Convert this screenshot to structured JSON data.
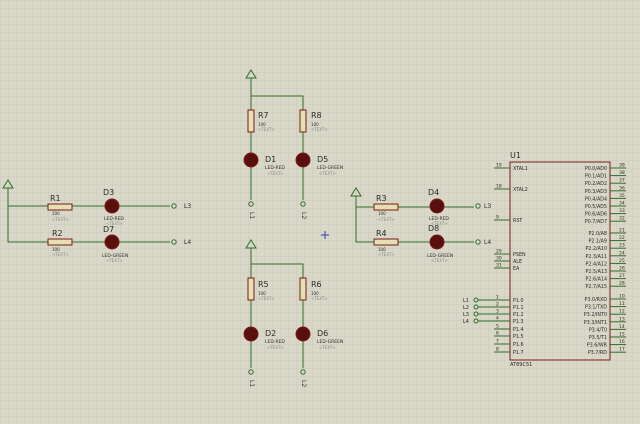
{
  "colors": {
    "background": "#d9d8c8",
    "grid": "#c2c1b0",
    "wire": "#2f6e2a",
    "body_outline": "#7a1a1a",
    "resistor_fill": "#e6dfb3",
    "led_fill": "#5a0f0f",
    "text": "#2a2a2a",
    "placeholder": "#8a8a8a",
    "marker": "#2a3cc4"
  },
  "resistors": [
    {
      "ref": "R1",
      "value": "100",
      "text": "<TEXT>"
    },
    {
      "ref": "R2",
      "value": "100",
      "text": "<TEXT>"
    },
    {
      "ref": "R7",
      "value": "100",
      "text": "<TEXT>"
    },
    {
      "ref": "R8",
      "value": "100",
      "text": "<TEXT>"
    },
    {
      "ref": "R5",
      "value": "100",
      "text": "<TEXT>"
    },
    {
      "ref": "R6",
      "value": "100",
      "text": "<TEXT>"
    },
    {
      "ref": "R3",
      "value": "100",
      "text": "<TEXT>"
    },
    {
      "ref": "R4",
      "value": "100",
      "text": "<TEXT>"
    }
  ],
  "leds": [
    {
      "ref": "D3",
      "type": "LED-RED",
      "text": "<TEXT>",
      "net": "L3"
    },
    {
      "ref": "D7",
      "type": "LED-GREEN",
      "text": "<TEXT>",
      "net": "L4"
    },
    {
      "ref": "D1",
      "type": "LED-RED",
      "text": "<TEXT>",
      "net": "L1"
    },
    {
      "ref": "D5",
      "type": "LED-GREEN",
      "text": "<TEXT>",
      "net": "L2"
    },
    {
      "ref": "D2",
      "type": "LED-RED",
      "text": "<TEXT>",
      "net": "L1"
    },
    {
      "ref": "D6",
      "type": "LED-GREEN",
      "text": "<TEXT>",
      "net": "L2"
    },
    {
      "ref": "D4",
      "type": "LED-RED",
      "text": "<TEXT>",
      "net": "L3"
    },
    {
      "ref": "D8",
      "type": "LED-GREEN",
      "text": "<TEXT>",
      "net": "L4"
    }
  ],
  "mcu": {
    "ref": "U1",
    "part": "AT89C51",
    "left_pins": [
      {
        "num": "19",
        "name": "XTAL1"
      },
      {
        "num": "18",
        "name": "XTAL2"
      },
      {
        "num": "9",
        "name": "RST"
      },
      {
        "num": "29",
        "name": "PSEN"
      },
      {
        "num": "30",
        "name": "ALE"
      },
      {
        "num": "31",
        "name": "EA"
      },
      {
        "num": "1",
        "name": "P1.0",
        "net": "L1"
      },
      {
        "num": "2",
        "name": "P1.1",
        "net": "L2"
      },
      {
        "num": "3",
        "name": "P1.2",
        "net": "L3"
      },
      {
        "num": "4",
        "name": "P1.3",
        "net": "L4"
      },
      {
        "num": "5",
        "name": "P1.4"
      },
      {
        "num": "6",
        "name": "P1.5"
      },
      {
        "num": "7",
        "name": "P1.6"
      },
      {
        "num": "8",
        "name": "P1.7"
      }
    ],
    "right_pins": [
      {
        "num": "39",
        "name": "P0.0/AD0"
      },
      {
        "num": "38",
        "name": "P0.1/AD1"
      },
      {
        "num": "37",
        "name": "P0.2/AD2"
      },
      {
        "num": "36",
        "name": "P0.3/AD3"
      },
      {
        "num": "35",
        "name": "P0.4/AD4"
      },
      {
        "num": "34",
        "name": "P0.5/AD5"
      },
      {
        "num": "33",
        "name": "P0.6/AD6"
      },
      {
        "num": "32",
        "name": "P0.7/AD7"
      },
      {
        "num": "21",
        "name": "P2.0/A8"
      },
      {
        "num": "22",
        "name": "P2.1/A9"
      },
      {
        "num": "23",
        "name": "P2.2/A10"
      },
      {
        "num": "24",
        "name": "P2.3/A11"
      },
      {
        "num": "25",
        "name": "P2.4/A12"
      },
      {
        "num": "26",
        "name": "P2.5/A13"
      },
      {
        "num": "27",
        "name": "P2.6/A14"
      },
      {
        "num": "28",
        "name": "P2.7/A15"
      },
      {
        "num": "10",
        "name": "P3.0/RXD"
      },
      {
        "num": "11",
        "name": "P3.1/TXD"
      },
      {
        "num": "12",
        "name": "P3.2/INT0"
      },
      {
        "num": "13",
        "name": "P3.3/INT1"
      },
      {
        "num": "14",
        "name": "P3.4/T0"
      },
      {
        "num": "15",
        "name": "P3.5/T1"
      },
      {
        "num": "16",
        "name": "P3.6/WR"
      },
      {
        "num": "17",
        "name": "P3.7/RD"
      }
    ]
  }
}
